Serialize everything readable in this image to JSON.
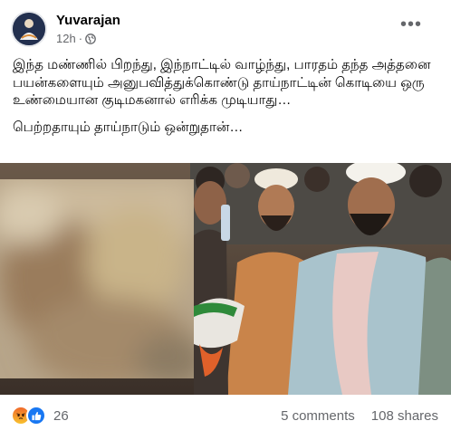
{
  "post": {
    "author": "Yuvarajan",
    "time": "12h",
    "dot": "·",
    "more_label": "•••",
    "paragraph1": "இந்த மண்ணில் பிறந்து, இந்நாட்டில் வாழ்ந்து, பாரதம் தந்த அத்தனை பயன்களையும் அனுபவித்துக்கொண்டு தாய்நாட்டின் கொடியை ஒரு உண்மையான குடிமகனால் எரிக்க முடியாது…",
    "paragraph2": "பெற்றதாயும் தாய்நாடும் ஒன்றுதான்…"
  },
  "image": {
    "privacy_icon": "globe-icon",
    "blurred_region": true
  },
  "footer": {
    "reactions": [
      "angry-reaction-icon",
      "like-reaction-icon"
    ],
    "reaction_count": "26",
    "comments": "5 comments",
    "shares": "108 shares"
  },
  "colors": {
    "text": "#050505",
    "secondary": "#65676b",
    "like": "#1877f2"
  }
}
